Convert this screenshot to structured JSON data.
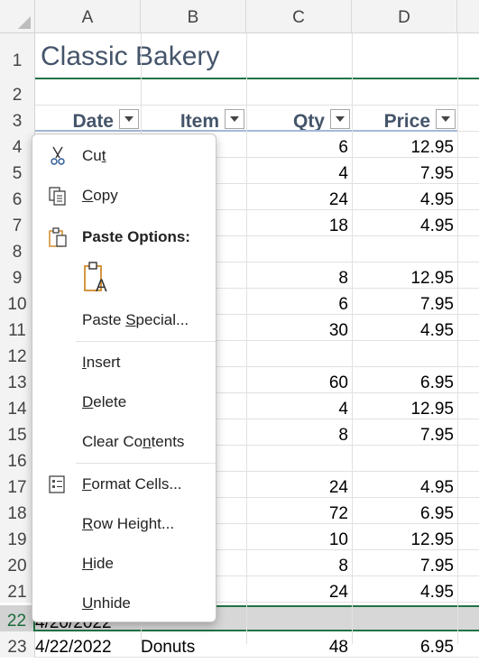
{
  "columns": [
    "A",
    "B",
    "C",
    "D"
  ],
  "rows": [
    {
      "n": "1"
    },
    {
      "n": "2"
    },
    {
      "n": "3"
    },
    {
      "n": "4",
      "c": "6",
      "d": "12.95"
    },
    {
      "n": "5",
      "c": "4",
      "d": "7.95"
    },
    {
      "n": "6",
      "c": "24",
      "d": "4.95"
    },
    {
      "n": "7",
      "c": "18",
      "d": "4.95"
    },
    {
      "n": "8"
    },
    {
      "n": "9",
      "c": "8",
      "d": "12.95"
    },
    {
      "n": "10",
      "c": "6",
      "d": "7.95"
    },
    {
      "n": "11",
      "c": "30",
      "d": "4.95"
    },
    {
      "n": "12"
    },
    {
      "n": "13",
      "c": "60",
      "d": "6.95"
    },
    {
      "n": "14",
      "c": "4",
      "d": "12.95"
    },
    {
      "n": "15",
      "c": "8",
      "d": "7.95"
    },
    {
      "n": "16"
    },
    {
      "n": "17",
      "c": "24",
      "d": "4.95"
    },
    {
      "n": "18",
      "c": "72",
      "d": "6.95"
    },
    {
      "n": "19",
      "c": "10",
      "d": "12.95"
    },
    {
      "n": "20",
      "c": "8",
      "d": "7.95"
    },
    {
      "n": "21",
      "c": "24",
      "d": "4.95"
    },
    {
      "n": "22",
      "a": "4/20/2022"
    },
    {
      "n": "23",
      "a": "4/22/2022",
      "b": "Donuts",
      "c": "48",
      "d": "6.95"
    }
  ],
  "sheet_title": "Classic Bakery",
  "headers": {
    "date": "Date",
    "item": "Item",
    "qty": "Qty",
    "price": "Price"
  },
  "menu": {
    "cut": "Cut",
    "cut_key": "t",
    "copy": "Copy",
    "copy_key": "C",
    "paste_options": "Paste Options:",
    "paste_special": "Paste Special...",
    "paste_special_key": "S",
    "insert": "Insert",
    "insert_key": "I",
    "delete": "Delete",
    "delete_key": "D",
    "clear_contents": "Clear Contents",
    "clear_contents_key": "N",
    "format_cells": "Format Cells...",
    "format_cells_key": "F",
    "row_height": "Row Height...",
    "row_height_key": "R",
    "hide": "Hide",
    "hide_key": "H",
    "unhide": "Unhide",
    "unhide_key": "U"
  },
  "colors": {
    "accent": "#217346",
    "header_text": "#44546a",
    "icon_orange": "#d08b2a"
  }
}
